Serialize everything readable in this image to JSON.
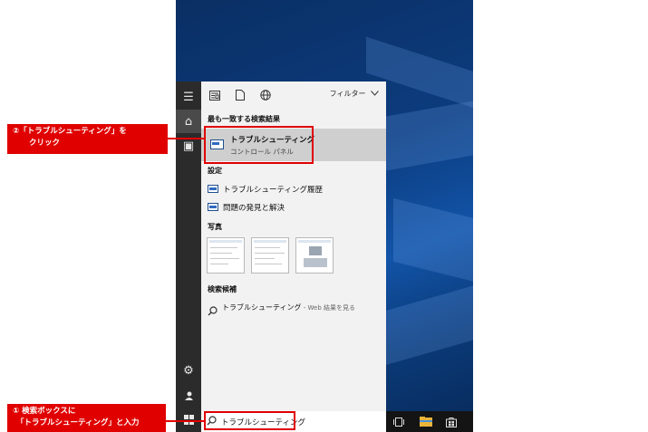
{
  "panel": {
    "filter_label": "フィルター",
    "best_match_heading": "最も一致する検索結果",
    "best_match": {
      "title": "トラブルシューティング",
      "subtitle": "コントロール パネル"
    },
    "settings_heading": "設定",
    "settings_items": [
      {
        "label": "トラブルシューティング履歴"
      },
      {
        "label": "問題の発見と解決"
      }
    ],
    "photos_heading": "写真",
    "suggestions_heading": "検索候補",
    "suggestion": {
      "query": "トラブルシューティング",
      "suffix": " - Web 結果を見る"
    }
  },
  "search": {
    "value": "トラブルシューティング"
  },
  "icons": {
    "rail": [
      "menu-icon",
      "home-icon",
      "documents-icon",
      "settings-icon",
      "user-icon",
      "windows-icon"
    ],
    "top": [
      "news-icon",
      "document-icon",
      "globe-icon",
      "chevron-down-icon"
    ],
    "taskbar": [
      "task-view-icon",
      "file-explorer-icon",
      "store-icon"
    ]
  },
  "annotations": {
    "step2_line1": "②「トラブルシューティング」を",
    "step2_line2": "クリック",
    "step1_line1": "① 検索ボックスに",
    "step1_line2": "「トラブルシューティング」と入力"
  },
  "colors": {
    "highlight": "#e00000",
    "rail": "#2b2b2b",
    "panel": "#f2f2f2",
    "selected": "#cfcfcf"
  }
}
